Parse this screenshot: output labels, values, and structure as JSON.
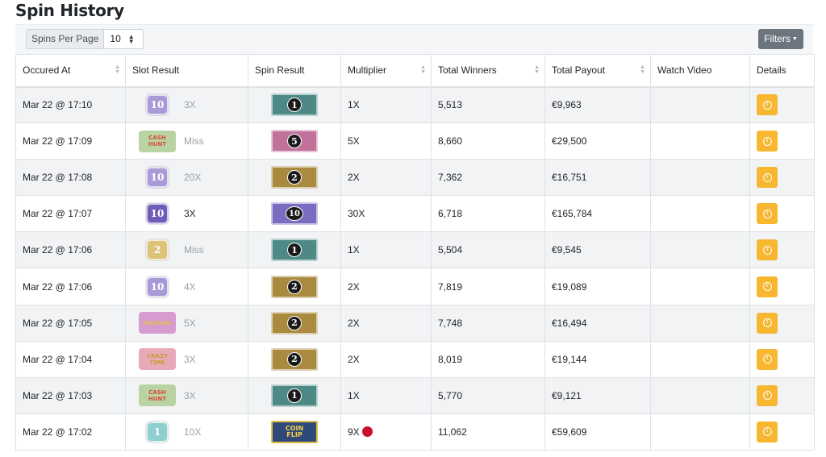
{
  "page": {
    "title": "Spin History"
  },
  "toolbar": {
    "per_page_label": "Spins Per Page",
    "per_page_value": "10",
    "filters_label": "Filters"
  },
  "table": {
    "headers": [
      "Occured At",
      "Slot Result",
      "Spin Result",
      "Multiplier",
      "Total Winners",
      "Total Payout",
      "Watch Video",
      "Details"
    ],
    "sortable": [
      true,
      false,
      false,
      true,
      true,
      true,
      false,
      false
    ],
    "rows": [
      {
        "occurred_at": "Mar 22 @ 17:10",
        "slot": {
          "kind": "num",
          "label": "10",
          "color": "#a89ad6"
        },
        "slot_mult": "3X",
        "slot_dim": true,
        "spin": {
          "kind": "num",
          "label": "1",
          "color": "#4e8a85"
        },
        "multiplier": "1X",
        "winners": "5,513",
        "payout": "€9,963"
      },
      {
        "occurred_at": "Mar 22 @ 17:09",
        "slot": {
          "kind": "word",
          "label": "CASH\nHUNT",
          "color": "#b9d3a2",
          "text": "#d94b3b"
        },
        "slot_mult": "Miss",
        "slot_dim": true,
        "spin": {
          "kind": "num",
          "label": "5",
          "color": "#c2719a"
        },
        "multiplier": "5X",
        "winners": "8,660",
        "payout": "€29,500"
      },
      {
        "occurred_at": "Mar 22 @ 17:08",
        "slot": {
          "kind": "num",
          "label": "10",
          "color": "#a89ad6"
        },
        "slot_mult": "20X",
        "slot_dim": true,
        "spin": {
          "kind": "num",
          "label": "2",
          "color": "#a98a3e"
        },
        "multiplier": "2X",
        "winners": "7,362",
        "payout": "€16,751"
      },
      {
        "occurred_at": "Mar 22 @ 17:07",
        "slot": {
          "kind": "num",
          "label": "10",
          "color": "#6e5cb8"
        },
        "slot_mult": "3X",
        "slot_dim": false,
        "spin": {
          "kind": "num",
          "label": "10",
          "color": "#7a6cc0"
        },
        "multiplier": "30X",
        "winners": "6,718",
        "payout": "€165,784"
      },
      {
        "occurred_at": "Mar 22 @ 17:06",
        "slot": {
          "kind": "num",
          "label": "2",
          "color": "#dcc27a"
        },
        "slot_mult": "Miss",
        "slot_dim": true,
        "spin": {
          "kind": "num",
          "label": "1",
          "color": "#4e8a85"
        },
        "multiplier": "1X",
        "winners": "5,504",
        "payout": "€9,545"
      },
      {
        "occurred_at": "Mar 22 @ 17:06",
        "slot": {
          "kind": "num",
          "label": "10",
          "color": "#a89ad6"
        },
        "slot_mult": "4X",
        "slot_dim": true,
        "spin": {
          "kind": "num",
          "label": "2",
          "color": "#a98a3e"
        },
        "multiplier": "2X",
        "winners": "7,819",
        "payout": "€19,089"
      },
      {
        "occurred_at": "Mar 22 @ 17:05",
        "slot": {
          "kind": "word",
          "label": "Pachinko",
          "color": "#d69bcf",
          "text": "#e0c04a"
        },
        "slot_mult": "5X",
        "slot_dim": true,
        "spin": {
          "kind": "num",
          "label": "2",
          "color": "#a98a3e"
        },
        "multiplier": "2X",
        "winners": "7,748",
        "payout": "€16,494"
      },
      {
        "occurred_at": "Mar 22 @ 17:04",
        "slot": {
          "kind": "word",
          "label": "CRAZY\nTIME",
          "color": "#e7aab8",
          "text": "#d0983a"
        },
        "slot_mult": "3X",
        "slot_dim": true,
        "spin": {
          "kind": "num",
          "label": "2",
          "color": "#a98a3e"
        },
        "multiplier": "2X",
        "winners": "8,019",
        "payout": "€19,144"
      },
      {
        "occurred_at": "Mar 22 @ 17:03",
        "slot": {
          "kind": "word",
          "label": "CASH\nHUNT",
          "color": "#b9d3a2",
          "text": "#d94b3b"
        },
        "slot_mult": "3X",
        "slot_dim": true,
        "spin": {
          "kind": "num",
          "label": "1",
          "color": "#4e8a85"
        },
        "multiplier": "1X",
        "winners": "5,770",
        "payout": "€9,121"
      },
      {
        "occurred_at": "Mar 22 @ 17:02",
        "slot": {
          "kind": "num",
          "label": "1",
          "color": "#8fcfcf"
        },
        "slot_mult": "10X",
        "slot_dim": true,
        "spin": {
          "kind": "coin",
          "label": "COIN\nFLIP",
          "color": "#2f4a78"
        },
        "multiplier": "9X",
        "red_dot": true,
        "winners": "11,062",
        "payout": "€59,609"
      }
    ]
  },
  "colors": {
    "details_button": "#f7b731",
    "filters_button": "#6c757d",
    "red_dot": "#c8102e"
  },
  "icons": {
    "details": "info-icon",
    "sort": "sort-arrows-icon",
    "select": "select-arrows-icon"
  }
}
